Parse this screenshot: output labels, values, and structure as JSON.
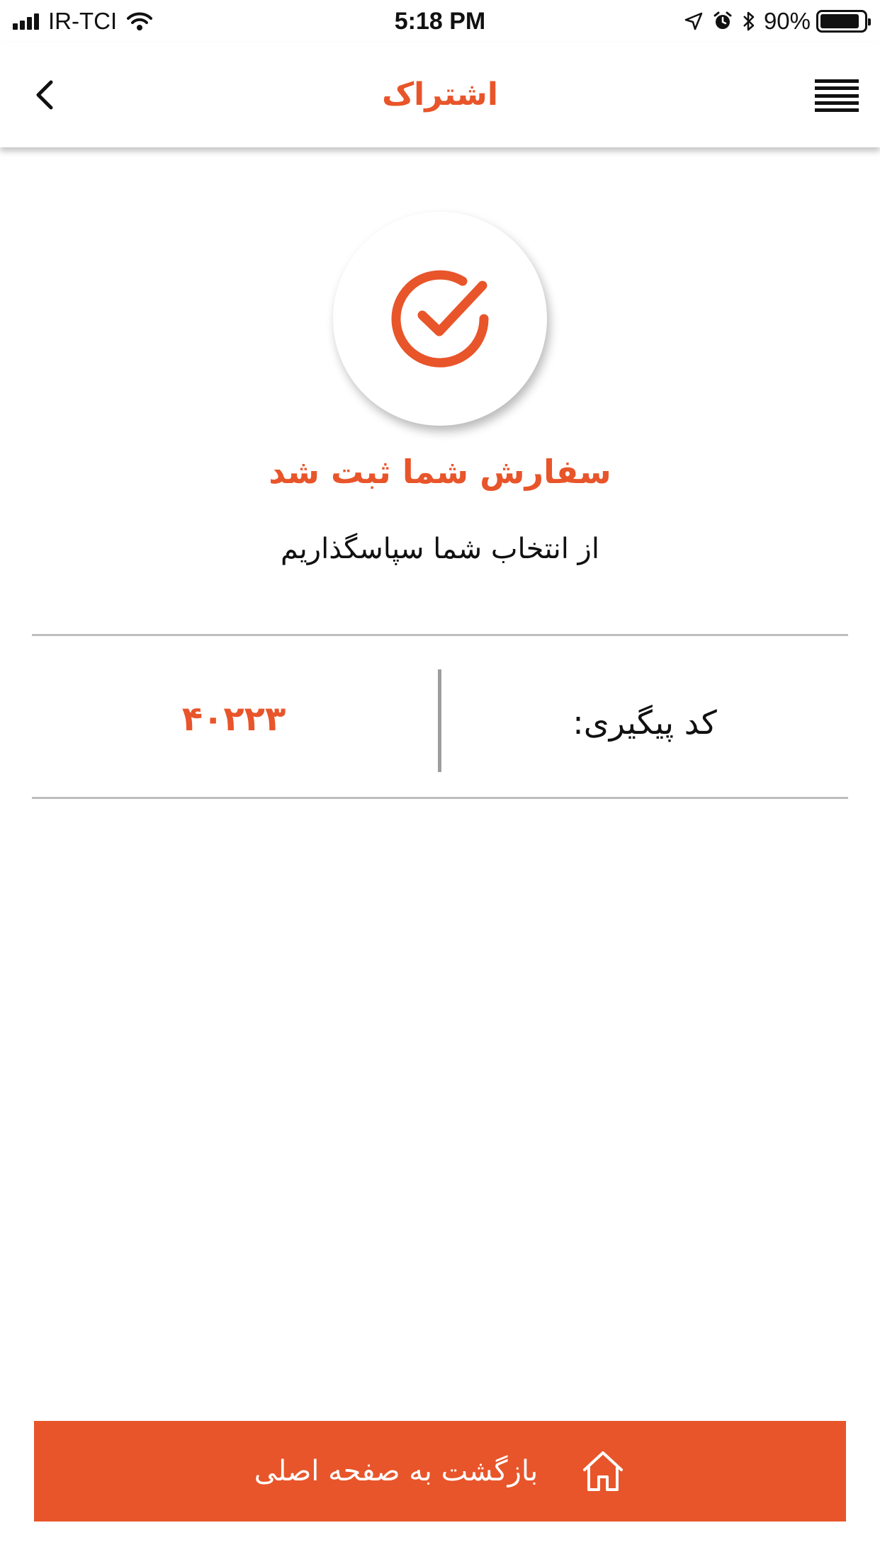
{
  "status_bar": {
    "carrier": "IR-TCI",
    "time": "5:18 PM",
    "battery_percent": "90%",
    "battery_level": 0.9,
    "icons": [
      "signal-icon",
      "wifi-icon",
      "location-icon",
      "alarm-icon",
      "bluetooth-icon",
      "battery-icon"
    ]
  },
  "nav": {
    "title": "اشتراک",
    "back_icon": "chevron-left-icon",
    "menu_icon": "hamburger-menu-icon"
  },
  "success": {
    "icon": "check-circle-icon",
    "title": "سفارش شما ثبت شد",
    "subtitle": "از انتخاب شما سپاسگذاریم"
  },
  "tracking": {
    "label": "کد پیگیری:",
    "value": "۴۰۲۲۳"
  },
  "home_button": {
    "label": "بازگشت به صفحه اصلی",
    "icon": "home-icon"
  },
  "colors": {
    "accent": "#e8552a",
    "text": "#111111",
    "divider": "#bdbdbd",
    "background": "#ffffff"
  }
}
